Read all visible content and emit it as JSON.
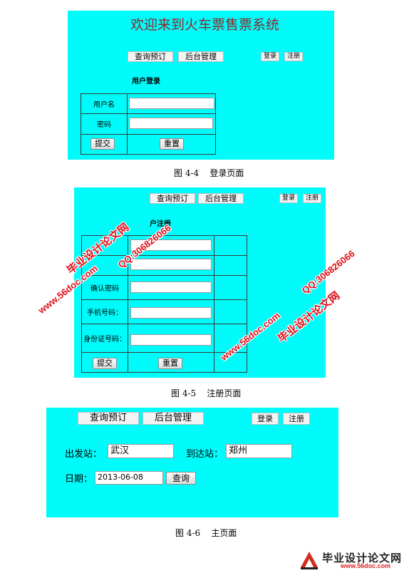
{
  "fig1": {
    "title": "欢迎来到火车票售票系统",
    "nav": [
      "查询预订",
      "后台管理"
    ],
    "auth": [
      "登录",
      "注册"
    ],
    "form_title": "用户登录",
    "labels": [
      "用户名",
      "密码"
    ],
    "submit": "提交",
    "reset": "重置",
    "caption": "图 4-4    登录页面"
  },
  "fig2": {
    "nav": [
      "查询预订",
      "后台管理"
    ],
    "auth": [
      "登录",
      "注册"
    ],
    "form_title": "户注册",
    "labels": [
      "",
      "",
      "确认密码",
      "手机号码：",
      "身份证号码："
    ],
    "submit": "提交",
    "reset": "重置",
    "caption": "图 4-5    注册页面"
  },
  "fig3": {
    "nav": [
      "查询预订",
      "后台管理"
    ],
    "auth": [
      "登录",
      "注册"
    ],
    "from_label": "出发站：",
    "from_value": "武汉",
    "to_label": "到达站：",
    "to_value": "郑州",
    "date_label": "日期：",
    "date_value": "2013-06-08",
    "query": "查询",
    "caption": "图 4-6    主页面"
  },
  "watermarks": {
    "site": "www.56doc.com",
    "qq": "QQ:306826066",
    "brand": "毕业设计论文网"
  },
  "logo": {
    "text": "毕业设计论文网",
    "sub": "www.56doc.com"
  },
  "colors": {
    "panel": "#00fbfb",
    "watermark": "#e0101a"
  }
}
